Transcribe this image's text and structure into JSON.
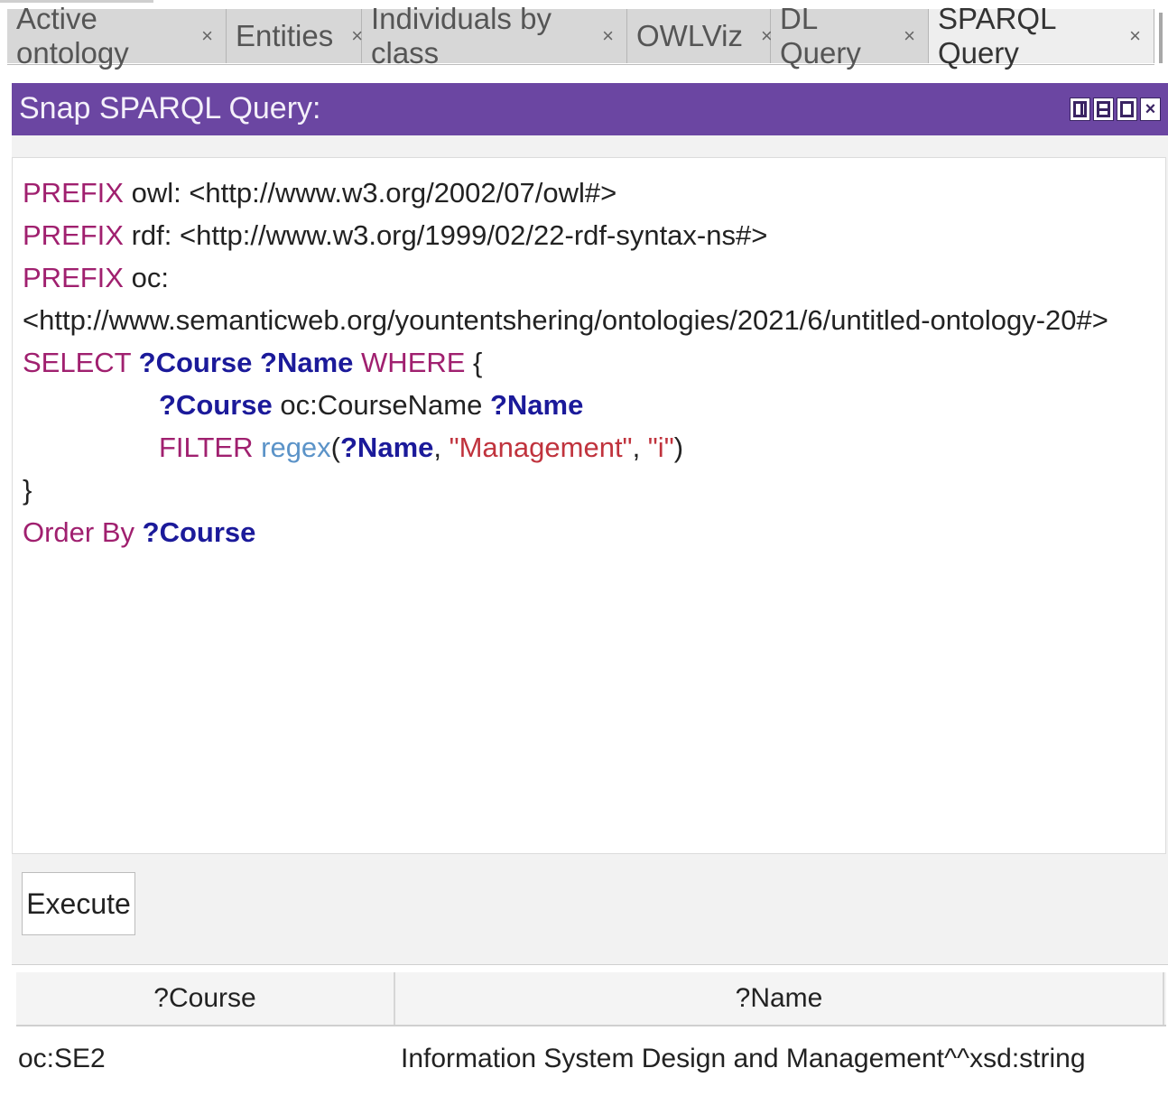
{
  "tabs": [
    {
      "label": "Active ontology",
      "close": "×",
      "active": false
    },
    {
      "label": "Entities",
      "close": "×",
      "active": false
    },
    {
      "label": "Individuals by class",
      "close": "×",
      "active": false
    },
    {
      "label": "OWLViz",
      "close": "×",
      "active": false
    },
    {
      "label": "DL Query",
      "close": "×",
      "active": false
    },
    {
      "label": "SPARQL Query",
      "close": "×",
      "active": true
    }
  ],
  "panel": {
    "title": "Snap SPARQL Query:",
    "accent_color": "#6b46a2"
  },
  "query": {
    "l1_kw": "PREFIX",
    "l1_rest": " owl: <http://www.w3.org/2002/07/owl#>",
    "l2_kw": "PREFIX",
    "l2_rest": " rdf: <http://www.w3.org/1999/02/22-rdf-syntax-ns#>",
    "l3_kw": "PREFIX",
    "l3_rest": " oc:",
    "l4_rest": "<http://www.semanticweb.org/yountentshering/ontologies/2021/6/untitled-ontology-20#>",
    "l5_kw1": "SELECT",
    "l5_var1": "?Course",
    "l5_var2": "?Name",
    "l5_kw2": "WHERE",
    "l5_brace": " {",
    "l6_var1": "?Course",
    "l6_pred": " oc:CourseName ",
    "l6_var2": "?Name",
    "l7_kw": "FILTER",
    "l7_fn": "regex",
    "l7_open": "(",
    "l7_var": "?Name",
    "l7_comma1": ", ",
    "l7_str1": "\"Management\"",
    "l7_comma2": ", ",
    "l7_str2": "\"i\"",
    "l7_close": ")",
    "l8_brace": "}",
    "l9_kw": "Order By",
    "l9_var": "?Course"
  },
  "execute_label": "Execute",
  "results": {
    "columns": [
      "?Course",
      "?Name"
    ],
    "rows": [
      [
        "oc:SE2",
        "Information System Design and Management^^xsd:string"
      ]
    ]
  }
}
